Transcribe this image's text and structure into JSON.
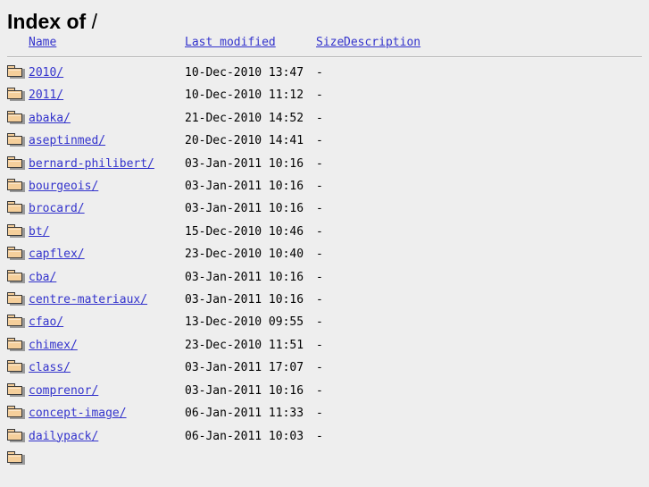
{
  "page": {
    "title_prefix": "Index of",
    "directory": "/"
  },
  "table": {
    "columns": [
      {
        "key": "icon",
        "label": ""
      },
      {
        "key": "name",
        "label": "Name"
      },
      {
        "key": "date",
        "label": "Last modified"
      },
      {
        "key": "size",
        "label": "Size"
      },
      {
        "key": "desc",
        "label": "Description"
      }
    ],
    "rows": [
      {
        "icon": "folder-icon",
        "name": "2010/",
        "date": "10-Dec-2010 13:47",
        "size": "-",
        "desc": ""
      },
      {
        "icon": "folder-icon",
        "name": "2011/",
        "date": "10-Dec-2010 11:12",
        "size": "-",
        "desc": ""
      },
      {
        "icon": "folder-icon",
        "name": "abaka/",
        "date": "21-Dec-2010 14:52",
        "size": "-",
        "desc": ""
      },
      {
        "icon": "folder-icon",
        "name": "aseptinmed/",
        "date": "20-Dec-2010 14:41",
        "size": "-",
        "desc": ""
      },
      {
        "icon": "folder-icon",
        "name": "bernard-philibert/",
        "date": "03-Jan-2011 10:16",
        "size": "-",
        "desc": ""
      },
      {
        "icon": "folder-icon",
        "name": "bourgeois/",
        "date": "03-Jan-2011 10:16",
        "size": "-",
        "desc": ""
      },
      {
        "icon": "folder-icon",
        "name": "brocard/",
        "date": "03-Jan-2011 10:16",
        "size": "-",
        "desc": ""
      },
      {
        "icon": "folder-icon",
        "name": "bt/",
        "date": "15-Dec-2010 10:46",
        "size": "-",
        "desc": ""
      },
      {
        "icon": "folder-icon",
        "name": "capflex/",
        "date": "23-Dec-2010 10:40",
        "size": "-",
        "desc": ""
      },
      {
        "icon": "folder-icon",
        "name": "cba/",
        "date": "03-Jan-2011 10:16",
        "size": "-",
        "desc": ""
      },
      {
        "icon": "folder-icon",
        "name": "centre-materiaux/",
        "date": "03-Jan-2011 10:16",
        "size": "-",
        "desc": ""
      },
      {
        "icon": "folder-icon",
        "name": "cfao/",
        "date": "13-Dec-2010 09:55",
        "size": "-",
        "desc": ""
      },
      {
        "icon": "folder-icon",
        "name": "chimex/",
        "date": "23-Dec-2010 11:51",
        "size": "-",
        "desc": ""
      },
      {
        "icon": "folder-icon",
        "name": "class/",
        "date": "03-Jan-2011 17:07",
        "size": "-",
        "desc": ""
      },
      {
        "icon": "folder-icon",
        "name": "comprenor/",
        "date": "03-Jan-2011 10:16",
        "size": "-",
        "desc": ""
      },
      {
        "icon": "folder-icon",
        "name": "concept-image/",
        "date": "06-Jan-2011 11:33",
        "size": "-",
        "desc": ""
      },
      {
        "icon": "folder-icon",
        "name": "dailypack/",
        "date": "06-Jan-2011 10:03",
        "size": "-",
        "desc": ""
      },
      {
        "icon": "folder-icon",
        "name": "",
        "date": "",
        "size": "",
        "desc": ""
      }
    ]
  },
  "colors": {
    "background": "#eeeeee",
    "link": "#3333cc",
    "text": "#000000",
    "rule": "#b4b4b4",
    "folder_fill": "#f5cf9b",
    "folder_outline": "#393939"
  }
}
